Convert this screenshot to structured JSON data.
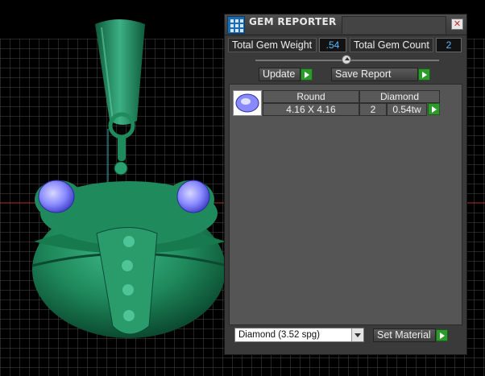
{
  "panel": {
    "title": "GEM REPORTER",
    "close_label": "✕",
    "total_gem_weight_label": "Total Gem Weight",
    "total_gem_weight_value": ".54",
    "total_gem_count_label": "Total Gem Count",
    "total_gem_count_value": "2",
    "slider_value_fraction": 0.5,
    "update_label": "Update",
    "save_report_label": "Save Report",
    "gem_row": {
      "shape": "Round",
      "material": "Diamond",
      "size": "4.16 X 4.16",
      "count": "2",
      "weight": "0.54tw"
    },
    "material_select_value": "Diamond     (3.52 spg)",
    "set_material_label": "Set Material"
  },
  "icons": {
    "app": "gem-reporter-app-icon",
    "close": "close-icon",
    "play": "green-arrow-icon",
    "gem": "round-gem-icon",
    "dropdown": "chevron-down-icon"
  },
  "colors": {
    "model": "#1f8a5c",
    "gem": "#8a8aff",
    "grid": "#4a4a4a",
    "panel_bg": "#3a3a3a",
    "value_text": "#5bb8ff",
    "accent_green": "#2e9a2e"
  }
}
